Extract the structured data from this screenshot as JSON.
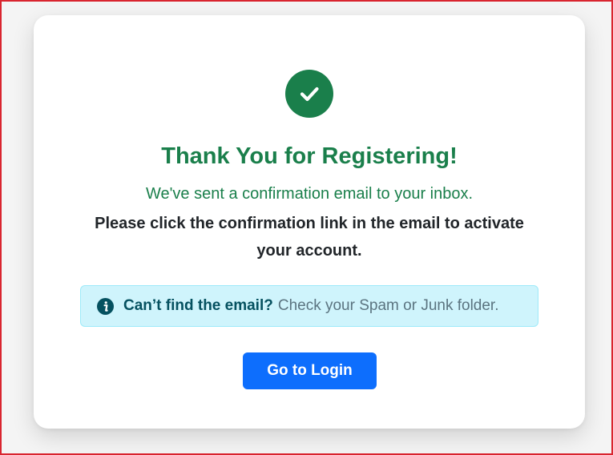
{
  "colors": {
    "success": "#1a7f4b",
    "alert_bg": "#cff4fc",
    "alert_border": "#9eeaf9",
    "alert_text": "#055160",
    "alert_muted": "#5b7480",
    "primary": "#0d6efd",
    "frame_border": "#d9252f"
  },
  "icons": {
    "success": "check-circle-icon",
    "alert": "info-circle-icon"
  },
  "confirmation": {
    "title": "Thank You for Registering!",
    "subtitle": "We've sent a confirmation email to your inbox.",
    "message": "Please click the confirmation link in the email to activate your account."
  },
  "alert": {
    "strong": "Can’t find the email?",
    "text": "Check your Spam or Junk folder."
  },
  "actions": {
    "login_label": "Go to Login"
  }
}
